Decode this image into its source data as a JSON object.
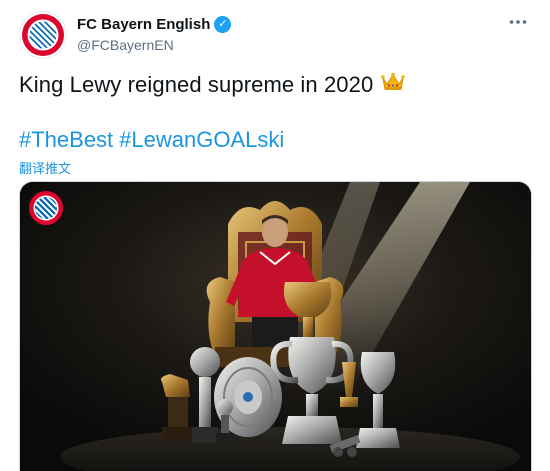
{
  "account": {
    "display_name": "FC Bayern English",
    "handle": "@FCBayernEN",
    "verified": true
  },
  "tweet": {
    "text": "King Lewy reigned supreme in 2020",
    "emoji": "crown",
    "hashtags": [
      "#TheBest",
      "#LewanGOALski"
    ],
    "translate_label": "翻译推文"
  },
  "media": {
    "logo_top_text": "FC BAYERN",
    "logo_bottom_text": "MÜNCHEN"
  },
  "colors": {
    "link": "#1b95e0",
    "verified": "#1da1f2",
    "bayern_red": "#dc052d",
    "bayern_blue": "#0066b2"
  },
  "icons": {
    "more": "more-horizontal-icon",
    "verified": "verified-badge-icon",
    "crown": "crown-emoji-icon"
  }
}
